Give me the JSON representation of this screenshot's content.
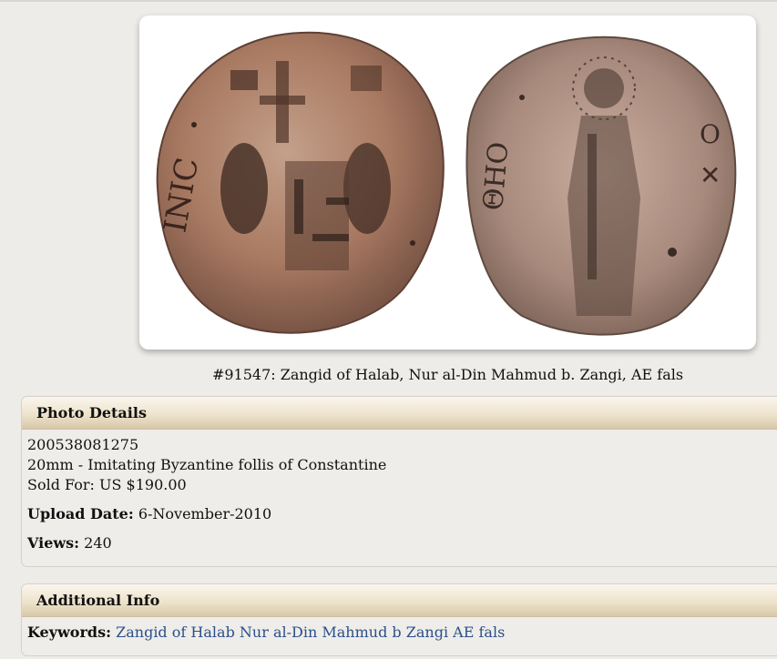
{
  "photo": {
    "alt": "Zangid of Halab coin obverse and reverse"
  },
  "caption": "#91547: Zangid of Halab, Nur al-Din Mahmud b. Zangi, AE fals",
  "photo_details": {
    "header": "Photo Details",
    "line1": "200538081275",
    "line2_size": "20mm",
    "line2_sep": " - ",
    "line2_desc": "Imitating Byzantine follis of Constantine",
    "line3": "Sold For: US $190.00",
    "upload_label": "Upload Date:",
    "upload_value": "6-November-2010",
    "views_label": "Views:",
    "views_value": "240"
  },
  "additional_info": {
    "header": "Additional Info",
    "keywords_label": "Keywords:",
    "keywords": [
      "Zangid",
      "of",
      "Halab",
      "Nur",
      "al-Din",
      "Mahmud",
      "b",
      "Zangi",
      "AE",
      "fals"
    ]
  },
  "colors": {
    "link": "#2a4f8a",
    "header_gradient_top": "#faf6ee",
    "header_gradient_bottom": "#d7c8a9",
    "coin_copper": "#a97a62"
  }
}
